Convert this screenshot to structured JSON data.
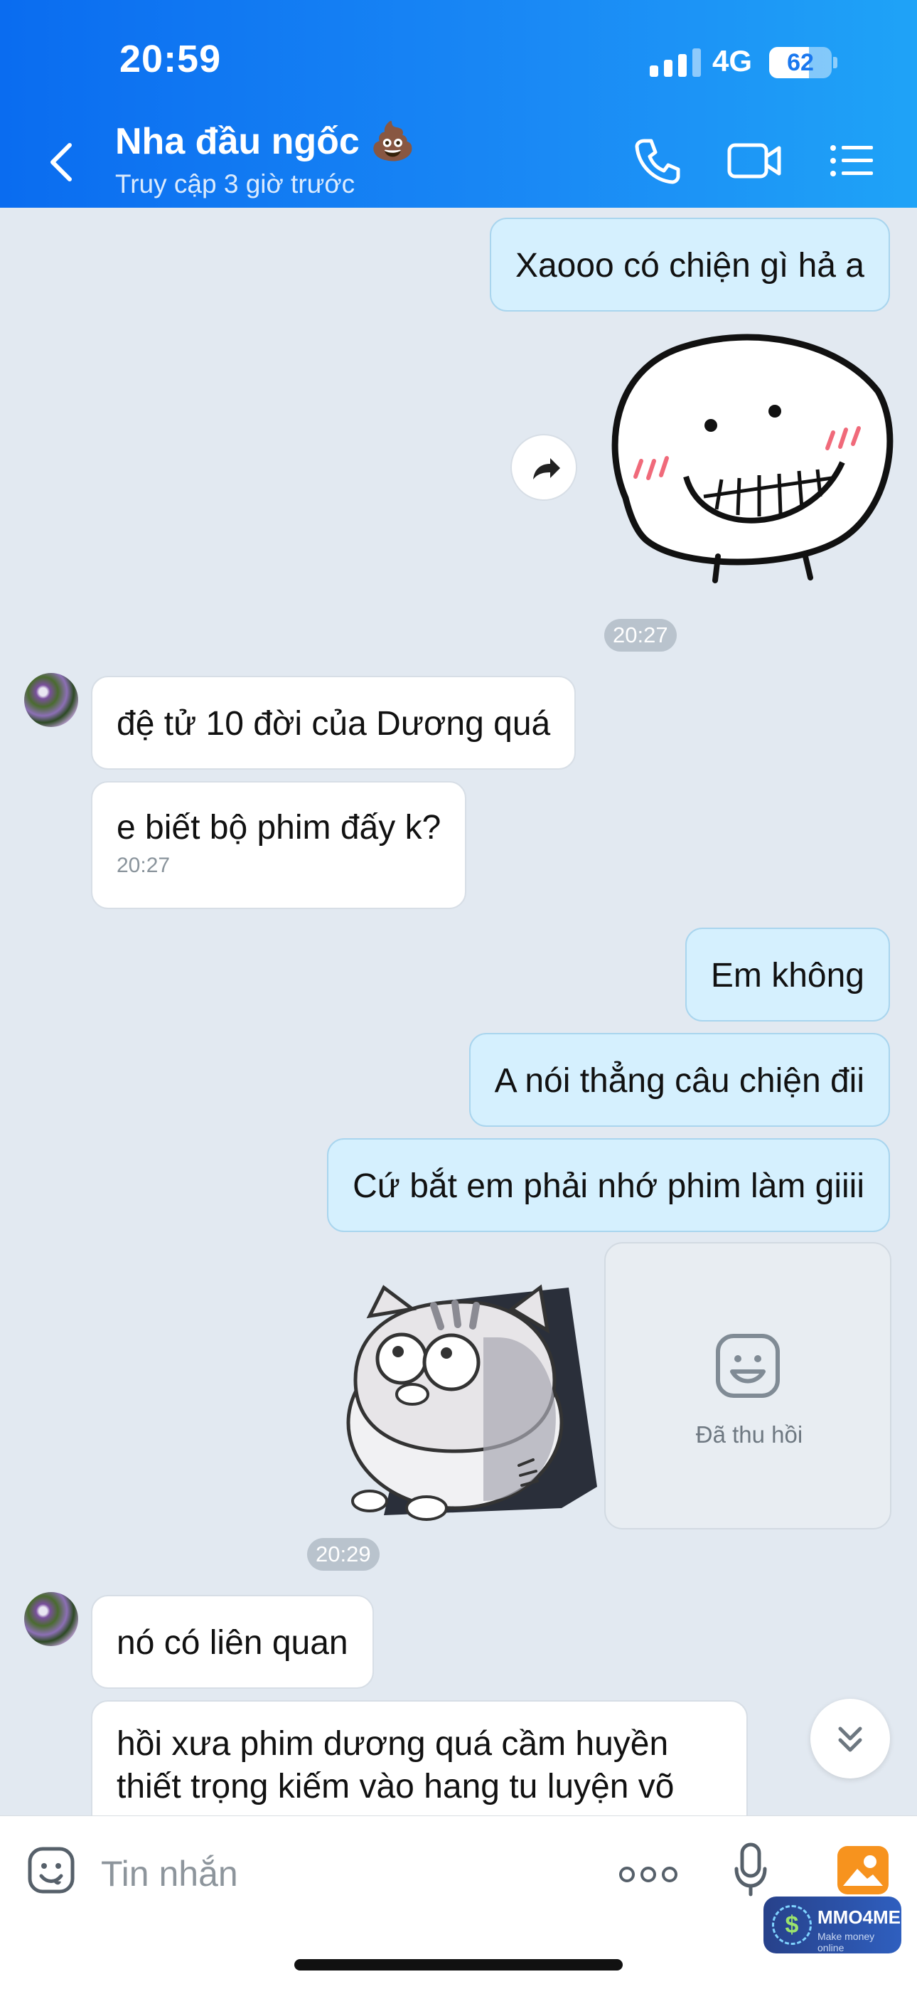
{
  "status_bar": {
    "time": "20:59",
    "network": "4G",
    "battery": "62"
  },
  "header": {
    "contact_name": "Nha đầu ngốc 💩",
    "last_seen": "Truy cập 3 giờ trước"
  },
  "messages": [
    {
      "from": "me",
      "text": "Xaooo có chiện gì hả a"
    },
    {
      "from": "me",
      "type": "sticker",
      "sticker": "grinning-face-sticker"
    },
    {
      "type": "timestamp",
      "text": "20:27"
    },
    {
      "from": "them",
      "text": "đệ tử 10 đời của Dương quá"
    },
    {
      "from": "them",
      "text": "e biết bộ phim đấy k?",
      "time": "20:27"
    },
    {
      "from": "me",
      "text": "Em không"
    },
    {
      "from": "me",
      "text": "A nói thẳng câu chiện đii"
    },
    {
      "from": "me",
      "text": "Cứ bắt em phải nhớ phim làm giiii"
    },
    {
      "from": "me",
      "type": "sticker",
      "sticker": "chubby-cat-sticker"
    },
    {
      "from": "me",
      "type": "recalled",
      "text": "Đã thu hồi"
    },
    {
      "type": "timestamp",
      "text": "20:29"
    },
    {
      "from": "them",
      "text": "nó có liên quan"
    },
    {
      "from": "them",
      "lines": [
        "hồi xưa phim dương quá cầm huyền",
        "thiết trọng kiếm vào hang tu luyện võ"
      ]
    }
  ],
  "input": {
    "placeholder": "Tin nhắn"
  },
  "watermark": {
    "brand": "MMO4ME",
    "tagline": "Make money online",
    "symbol": "$"
  },
  "colors": {
    "header_start": "#0a6cf0",
    "header_end": "#1fa3f7",
    "my_bubble": "#d5f0fe",
    "their_bubble": "#ffffff",
    "chat_bg": "#e2e9f1"
  }
}
